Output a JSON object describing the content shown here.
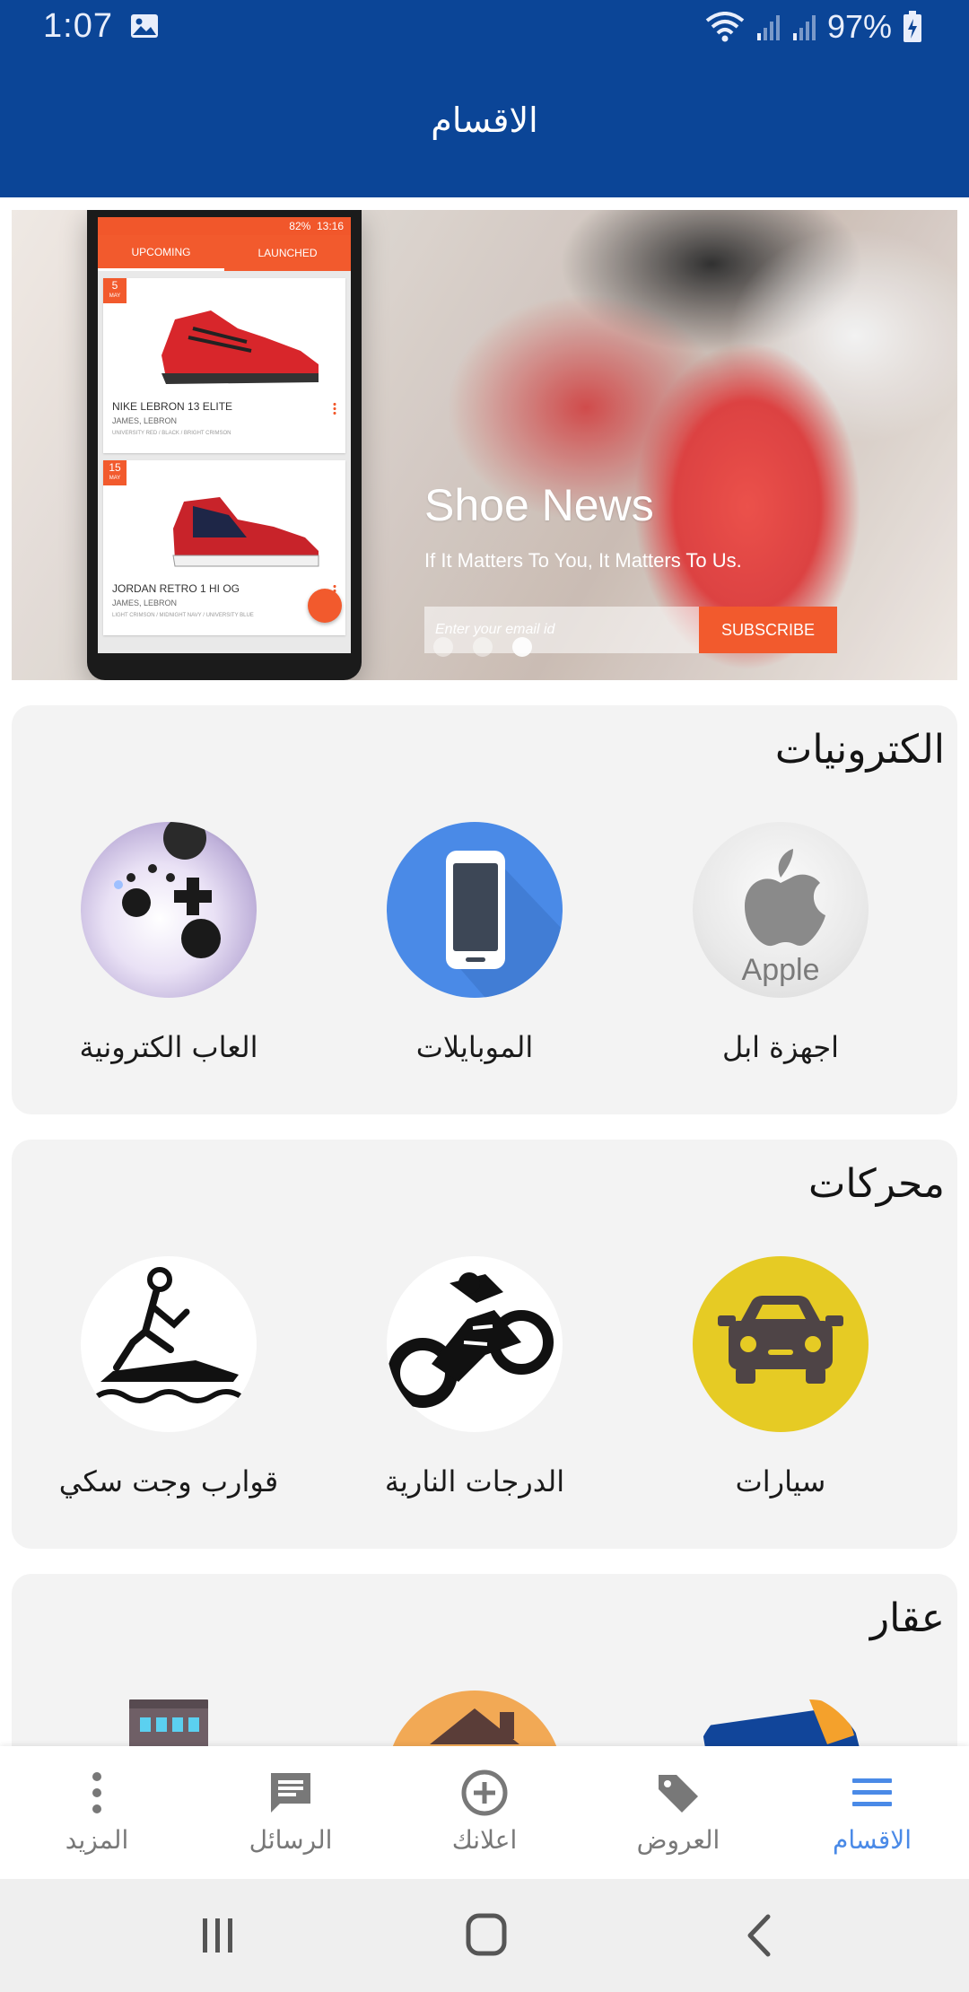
{
  "status_bar": {
    "time": "1:07",
    "battery": "97%"
  },
  "appbar": {
    "title": "الاقسام",
    "color": "#0B4597"
  },
  "banner": {
    "title": "Shoe News",
    "subtitle": "If It Matters To You, It Matters To Us.",
    "email_placeholder": "Enter your email id",
    "subscribe_label": "SUBSCRIBE",
    "phone": {
      "time": "13:16",
      "battery": "82%",
      "tabs": [
        "UPCOMING",
        "LAUNCHED"
      ],
      "cards": [
        {
          "day": "5",
          "month": "MAY",
          "name": "NIKE LEBRON 13 ELITE",
          "sub": "JAMES, LEBRON",
          "colors": "UNIVERSITY RED / BLACK / BRIGHT CRIMSON"
        },
        {
          "day": "15",
          "month": "MAY",
          "name": "JORDAN RETRO 1 HI OG",
          "sub": "JAMES, LEBRON",
          "colors": "LIGHT CRIMSON / MIDNIGHT NAVY / UNIVERSITY BLUE"
        }
      ]
    }
  },
  "sections": [
    {
      "title": "الكترونيات",
      "items": [
        {
          "label": "اجهزة ابل",
          "icon": "apple-logo-icon",
          "image_text": "Apple"
        },
        {
          "label": "الموبايلات",
          "icon": "mobile-phone-icon"
        },
        {
          "label": "العاب الكترونية",
          "icon": "game-controller-icon"
        }
      ]
    },
    {
      "title": "محركات",
      "items": [
        {
          "label": "سيارات",
          "icon": "car-icon"
        },
        {
          "label": "الدرجات النارية",
          "icon": "motorcycle-icon"
        },
        {
          "label": "قوارب وجت سكي",
          "icon": "jet-ski-icon"
        }
      ]
    },
    {
      "title": "عقار",
      "items": [
        {
          "icon": "real-estate-tag-icon"
        },
        {
          "icon": "house-icon"
        },
        {
          "icon": "building-icon"
        }
      ]
    }
  ],
  "bottom_nav": [
    {
      "label": "الاقسام",
      "icon": "menu-icon",
      "active": true
    },
    {
      "label": "العروض",
      "icon": "tag-icon"
    },
    {
      "label": "اعلانك",
      "icon": "add-circle-icon"
    },
    {
      "label": "الرسائل",
      "icon": "message-icon"
    },
    {
      "label": "المزيد",
      "icon": "more-icon"
    }
  ],
  "colors": {
    "active_nav": "#4a8ae7",
    "inactive_nav": "#787878",
    "section_bg": "#f3f3f3",
    "accent_orange": "#f25a2d"
  }
}
